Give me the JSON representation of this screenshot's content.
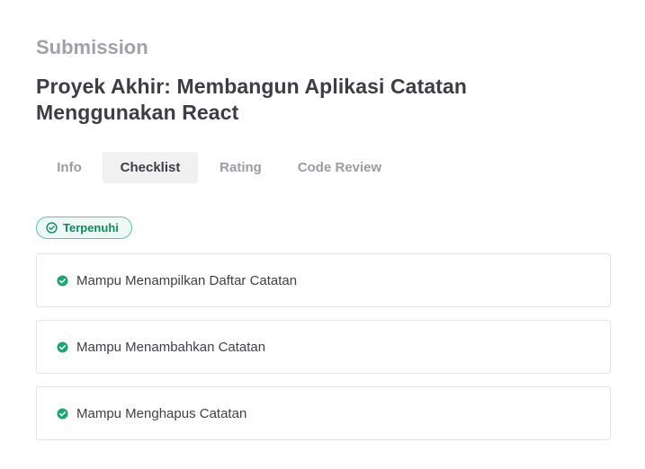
{
  "header": {
    "eyebrow": "Submission",
    "title": "Proyek Akhir: Membangun Aplikasi Catatan Menggunakan React"
  },
  "tabs": [
    {
      "label": "Info",
      "active": false
    },
    {
      "label": "Checklist",
      "active": true
    },
    {
      "label": "Rating",
      "active": false
    },
    {
      "label": "Code Review",
      "active": false
    }
  ],
  "status": {
    "label": "Terpenuhi",
    "icon": "check-circle-outline-icon",
    "color": "#0e8a5e"
  },
  "checklist": [
    {
      "label": "Mampu Menampilkan Daftar Catatan",
      "icon": "check-circle-icon"
    },
    {
      "label": "Mampu Menambahkan Catatan",
      "icon": "check-circle-icon"
    },
    {
      "label": "Mampu Menghapus Catatan",
      "icon": "check-circle-icon"
    }
  ],
  "colors": {
    "accent": "#0e8a5e",
    "check": "#19a970"
  }
}
